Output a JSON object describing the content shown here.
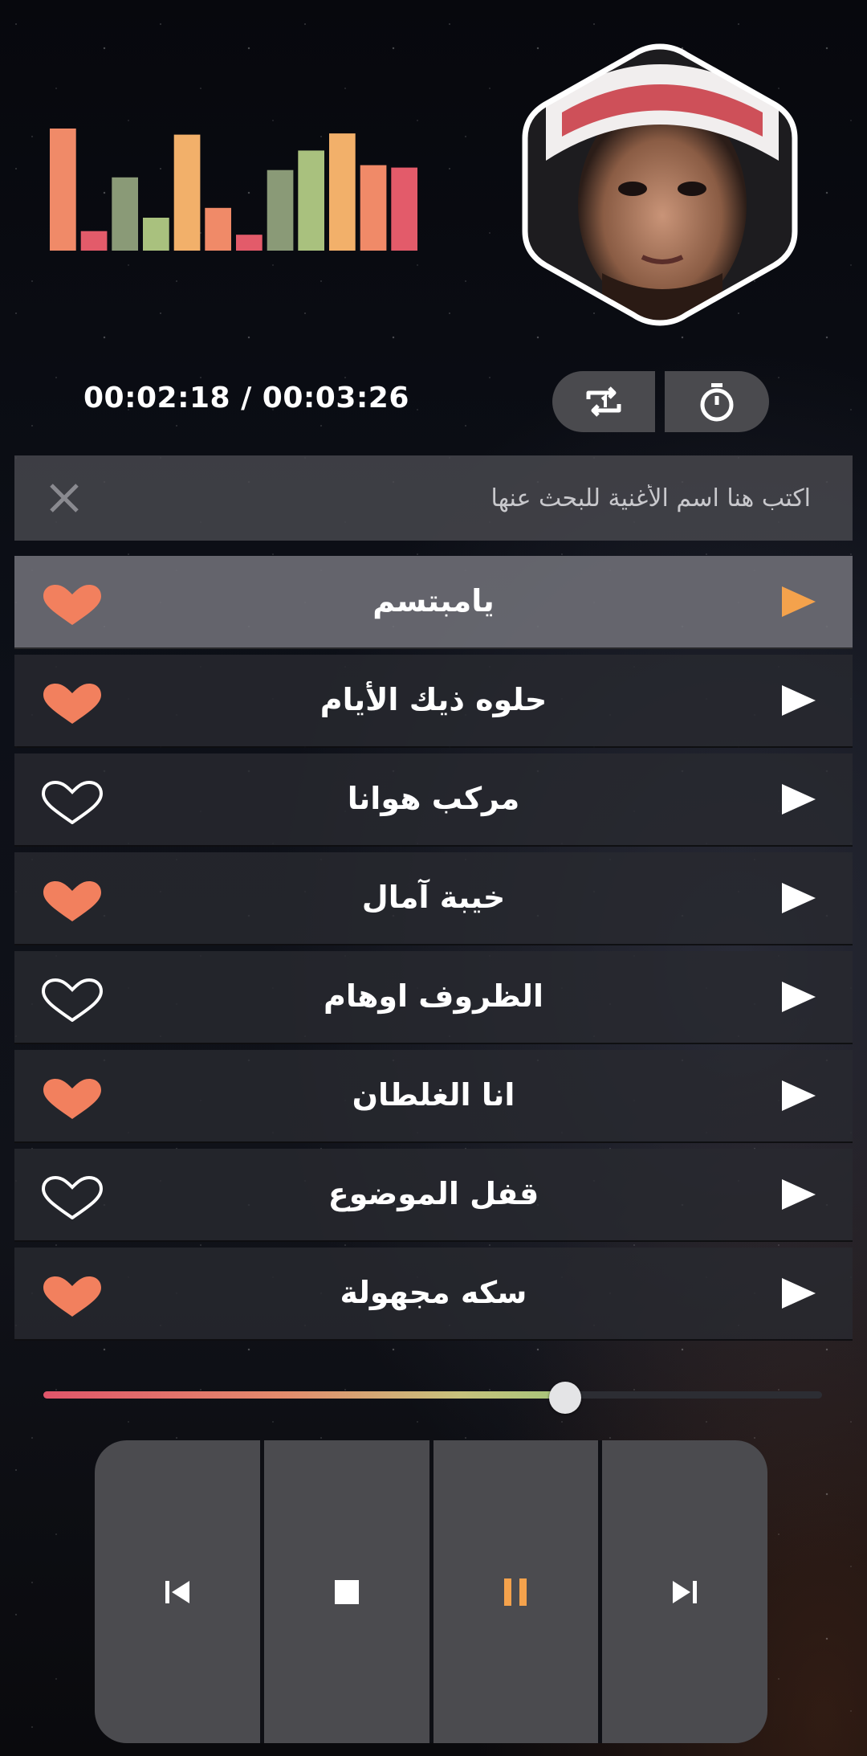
{
  "player": {
    "elapsed": "00:02:18",
    "separator": " / ",
    "duration": "00:03:26",
    "time_text": "00:02:18 / 00:03:26",
    "progress_fraction": 0.67
  },
  "equalizer": {
    "bar_levels": [
      1.0,
      0.16,
      0.6,
      0.27,
      0.95,
      0.35,
      0.13,
      0.66,
      0.82,
      0.96,
      0.7,
      0.68
    ],
    "bar_colors": [
      "#f08a68",
      "#e35b6a",
      "#8a9a77",
      "#a9c17e",
      "#f2b06a",
      "#f08a68",
      "#e35b6a",
      "#8a9a77",
      "#a9c17e",
      "#f2b06a",
      "#f08a68",
      "#e35b6a"
    ]
  },
  "search": {
    "placeholder": "اكتب هنا اسم الأغنية للبحث عنها",
    "clear_icon": "close-icon"
  },
  "mode_buttons": {
    "repeat_icon": "repeat-one-icon",
    "timer_icon": "timer-icon"
  },
  "songs": [
    {
      "title": "يامبتسم",
      "favorite": true,
      "active": true
    },
    {
      "title": "حلوه ذيك الأيام",
      "favorite": true,
      "active": false
    },
    {
      "title": "مركب هوانا",
      "favorite": false,
      "active": false
    },
    {
      "title": "خيبة آمال",
      "favorite": true,
      "active": false
    },
    {
      "title": "الظروف اوهام",
      "favorite": false,
      "active": false
    },
    {
      "title": "انا الغلطان",
      "favorite": true,
      "active": false
    },
    {
      "title": "قفل الموضوع",
      "favorite": false,
      "active": false
    },
    {
      "title": "سكه مجهولة",
      "favorite": true,
      "active": false
    }
  ],
  "controls": [
    "previous-icon",
    "stop-icon",
    "pause-icon",
    "next-icon"
  ],
  "colors": {
    "accent_orange": "#f4a24c",
    "heart": "#f2805e",
    "active_row": "#6e6e76",
    "row": "#28293a"
  }
}
